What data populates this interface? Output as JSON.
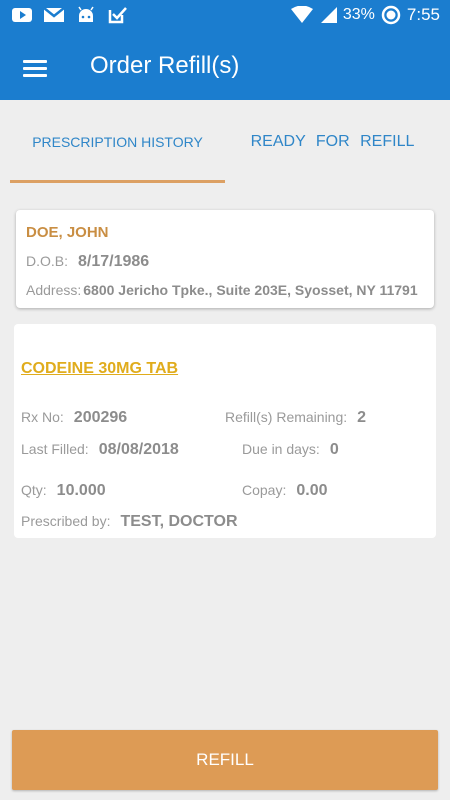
{
  "status_bar": {
    "battery": "33%",
    "time": "7:55",
    "icons": [
      "youtube-icon",
      "gmail-icon",
      "android-icon",
      "task-icon",
      "wifi-icon",
      "signal-icon",
      "battery-icon"
    ]
  },
  "toolbar": {
    "title": "Order Refill(s)",
    "menu_icon": "hamburger-menu-icon"
  },
  "tabs": [
    {
      "label": "PRESCRIPTION HISTORY",
      "active": true
    },
    {
      "label": "READY FOR REFILL",
      "active": false
    }
  ],
  "patient": {
    "name": "DOE, JOHN",
    "dob_label": "D.O.B:",
    "dob": "8/17/1986",
    "address_label": "Address:",
    "address": "6800 Jericho Tpke., Suite 203E, Syosset, NY 11791"
  },
  "prescription": {
    "name": "CODEINE 30MG TAB",
    "rx_label": "Rx No:",
    "rx_no": "200296",
    "refills_label": "Refill(s) Remaining:",
    "refills": "2",
    "last_filled_label": "Last Filled:",
    "last_filled": "08/08/2018",
    "due_label": "Due in days:",
    "due": "0",
    "qty_label": "Qty:",
    "qty": "10.000",
    "copay_label": "Copay:",
    "copay": "0.00",
    "prescribed_label": "Prescribed by:",
    "prescribed_by": "TEST, DOCTOR"
  },
  "refill_button": {
    "label": "REFILL"
  },
  "colors": {
    "app_bar": "#1b7dcf",
    "tab_text": "#2f86c8",
    "tab_indicator": "#dca063",
    "patient_name": "#c98e43",
    "medication_name": "#e0ac1c",
    "refill_button": "#dd9b55"
  }
}
